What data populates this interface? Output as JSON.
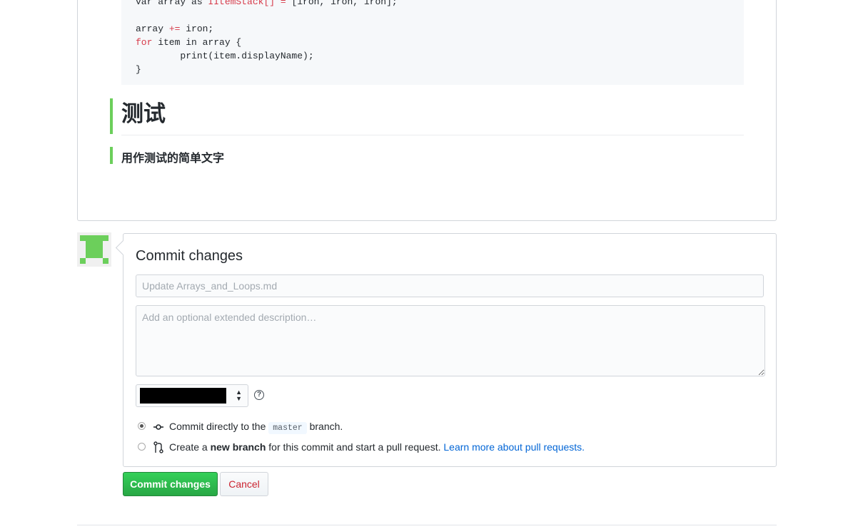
{
  "preview": {
    "code_lines": [
      {
        "a": "var array as ",
        "b": "IItemStack",
        "c": "[] ",
        "d": "=",
        "e": " [iron, iron, iron];"
      },
      {
        "a": "",
        "b": "",
        "c": "",
        "d": "",
        "e": ""
      },
      {
        "a": "array ",
        "b": "",
        "c": "",
        "d": "+=",
        "e": " iron;"
      },
      {
        "a": "",
        "b": "for",
        "c": " item in array {",
        "d": "",
        "e": ""
      },
      {
        "a": "        print(item.displayName);",
        "b": "",
        "c": "",
        "d": "",
        "e": ""
      },
      {
        "a": "}",
        "b": "",
        "c": "",
        "d": "",
        "e": ""
      }
    ],
    "heading": "测试",
    "paragraph": "用作测试的简单文字"
  },
  "commit": {
    "title": "Commit changes",
    "summary_placeholder": "Update Arrays_and_Loops.md",
    "description_placeholder": "Add an optional extended description…",
    "author_select": "",
    "help_icon": "?",
    "options": {
      "direct": {
        "prefix": "Commit directly to the",
        "branch": "master",
        "suffix": "branch."
      },
      "new_branch": {
        "prefix": "Create a",
        "bold": "new branch",
        "suffix": "for this commit and start a pull request.",
        "link": "Learn more about pull requests."
      }
    }
  },
  "buttons": {
    "commit": "Commit changes",
    "cancel": "Cancel"
  },
  "colors": {
    "accent_green": "#6ccf5b",
    "primary_button": "#28a745",
    "cancel_text": "#cb2431",
    "link": "#0366d6"
  },
  "icons": {
    "commit": "git-commit-icon",
    "pull_request": "git-pull-request-icon",
    "help": "question-icon",
    "select": "select-caret-icon"
  }
}
